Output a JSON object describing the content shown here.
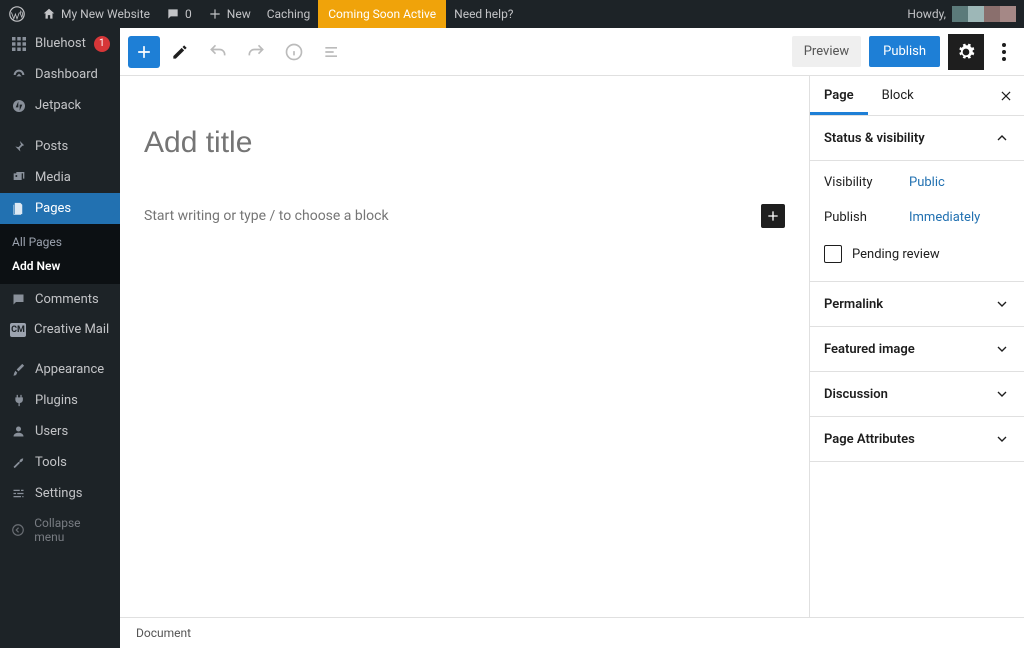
{
  "adminbar": {
    "site_title": "My New Website",
    "comments_count": "0",
    "new_label": "New",
    "caching_label": "Caching",
    "coming_soon_label": "Coming Soon Active",
    "help_label": "Need help?",
    "howdy_label": "Howdy,",
    "swatches": [
      "#5b7a7a",
      "#9db7b7",
      "#8a6f6d",
      "#8a6f6d"
    ]
  },
  "sidebar": {
    "bluehost": "Bluehost",
    "bluehost_badge": "1",
    "dashboard": "Dashboard",
    "jetpack": "Jetpack",
    "posts": "Posts",
    "media": "Media",
    "pages": "Pages",
    "all_pages": "All Pages",
    "add_new": "Add New",
    "comments": "Comments",
    "creative_mail": "Creative Mail",
    "appearance": "Appearance",
    "plugins": "Plugins",
    "users": "Users",
    "tools": "Tools",
    "settings": "Settings",
    "collapse": "Collapse menu"
  },
  "toolbar": {
    "preview": "Preview",
    "publish": "Publish"
  },
  "canvas": {
    "title_placeholder": "Add title",
    "content_placeholder": "Start writing or type / to choose a block"
  },
  "settings_panel": {
    "tab_page": "Page",
    "tab_block": "Block",
    "status_heading": "Status & visibility",
    "visibility_label": "Visibility",
    "visibility_value": "Public",
    "publish_label": "Publish",
    "publish_value": "Immediately",
    "pending_review": "Pending review",
    "permalink": "Permalink",
    "featured_image": "Featured image",
    "discussion": "Discussion",
    "page_attributes": "Page Attributes"
  },
  "footer": {
    "breadcrumb": "Document"
  }
}
